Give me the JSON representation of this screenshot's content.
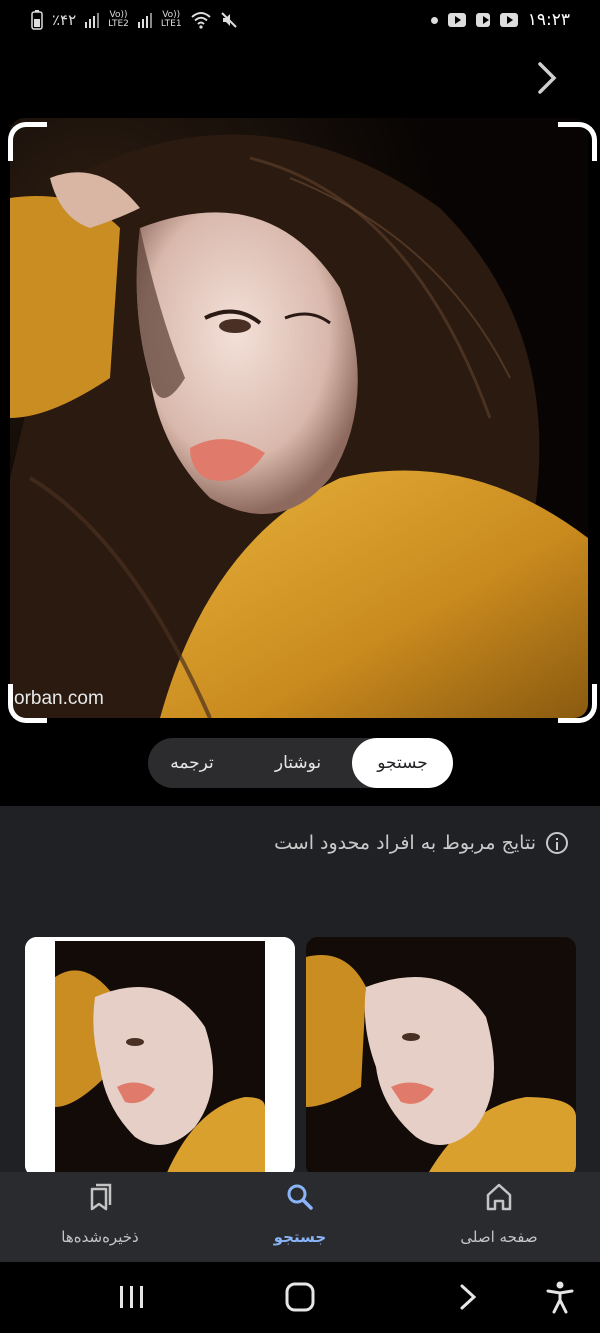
{
  "status_bar": {
    "time": "۱۹:۲۳",
    "battery": "٪۴۲",
    "sim1": "LTE1",
    "sim2": "LTE2",
    "volte": "Vo))",
    "icons": [
      "notification-dot",
      "youtube-icon",
      "camera-app-icon",
      "youtube-icon",
      "battery-icon",
      "signal-icon",
      "wifi-icon",
      "mute-icon"
    ]
  },
  "photo": {
    "watermark": "orban.com"
  },
  "mode_tabs": {
    "search": "جستجو",
    "text": "نوشتار",
    "translate": "ترجمه",
    "selected": "جستجو"
  },
  "results": {
    "notice": "نتایج مربوط به افراد محدود است"
  },
  "bottom_nav": {
    "home": "صفحه اصلی",
    "search": "جستجو",
    "saved": "ذخیره‌شده‌ها",
    "active": "جستجو"
  },
  "colors": {
    "accent": "#8ab4f8",
    "panel": "#202124",
    "nav_bg": "#2a2b2e",
    "sweater": "#d9a02e"
  }
}
